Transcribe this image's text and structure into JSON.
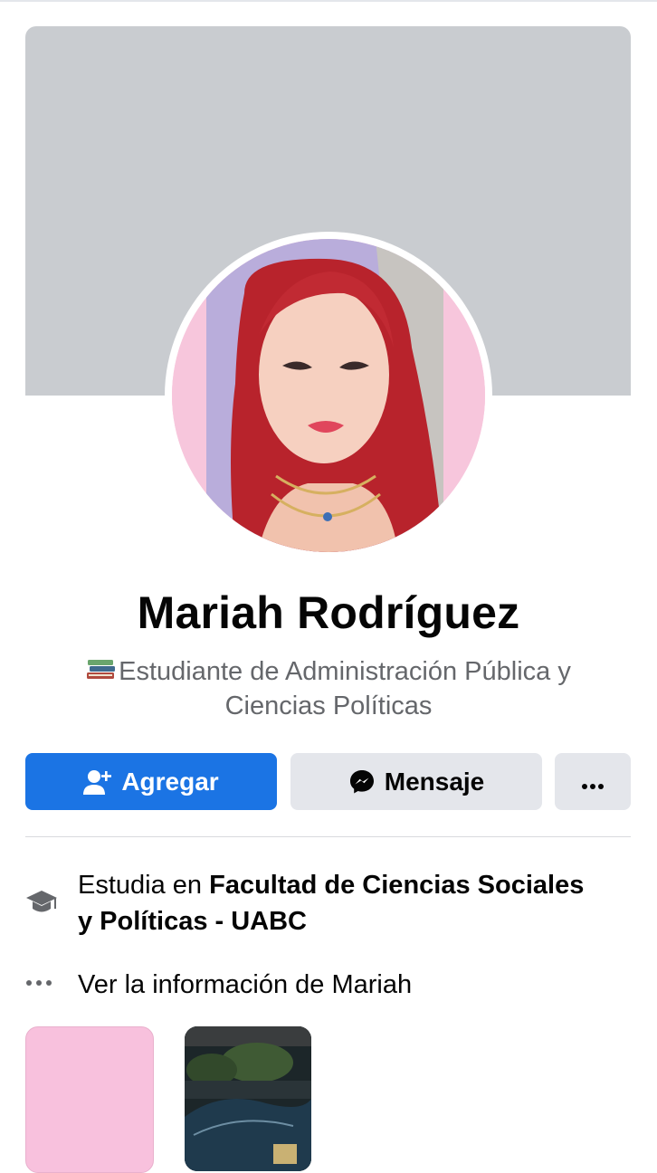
{
  "profile": {
    "name": "Mariah Rodríguez",
    "bio_emoji": "books-emoji",
    "bio": "Estudiante de Administración Pública y Ciencias Políticas"
  },
  "actions": {
    "add_label": "Agregar",
    "add_icon": "add-friend-icon",
    "message_label": "Mensaje",
    "message_icon": "messenger-icon",
    "more_icon": "more-dots-icon"
  },
  "info": {
    "education_prefix": "Estudia en ",
    "education_school": "Facultad de Ciencias Sociales y Políticas - UABC",
    "education_icon": "graduation-cap-icon",
    "see_more_label": "Ver la información de Mariah",
    "see_more_icon": "more-dots-icon"
  },
  "colors": {
    "primary_blue": "#1b74e4",
    "secondary_button": "#e4e6eb",
    "cover_gray": "#c9ccd0",
    "avatar_pink": "#f7c6dc",
    "text_primary": "#050505",
    "text_secondary": "#65676b"
  }
}
